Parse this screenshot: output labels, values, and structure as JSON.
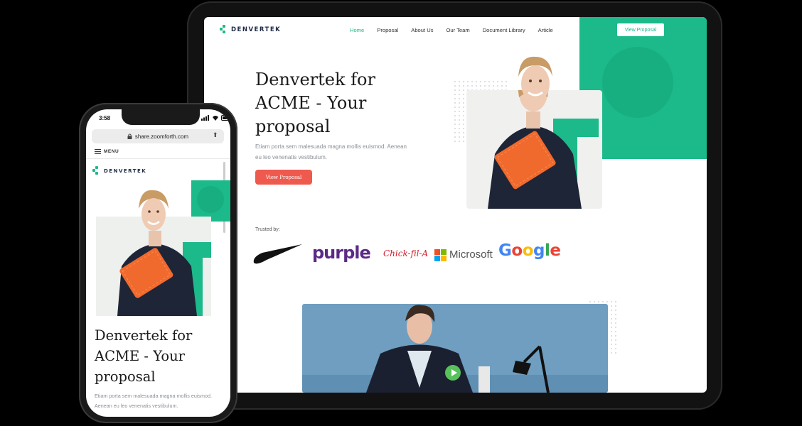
{
  "tablet": {
    "logo_text": "DENVERTEK",
    "nav": [
      "Home",
      "Proposal",
      "About Us",
      "Our Team",
      "Document Library",
      "Article"
    ],
    "nav_active": "Home",
    "nav_button": "View Proposal",
    "hero_title": "Denvertek for ACME - Your proposal",
    "hero_subtitle": "Etiam porta sem malesuada magna mollis euismod. Aenean eu leo venenatis vestibulum.",
    "cta_label": "View Proposal",
    "trusted_label": "Trusted by:",
    "brands": [
      "purple",
      "Chick-fil-A",
      "Microsoft",
      "Google"
    ],
    "brand_icons": [
      "nike-swoosh-icon",
      "microsoft-icon"
    ]
  },
  "phone": {
    "time": "3:58",
    "url": "share.zoomforth.com",
    "menu_label": "MENU",
    "logo_text": "DENVERTEK",
    "hero_title": "Denvertek for ACME - Your proposal",
    "hero_subtitle": "Etiam porta sem malesuada magna mollis euismod. Aenean eu leo venenatis vestibulum."
  },
  "colors": {
    "brand_green": "#1cb98a",
    "cta_red": "#ef5a4e",
    "navy": "#1f2a44"
  }
}
